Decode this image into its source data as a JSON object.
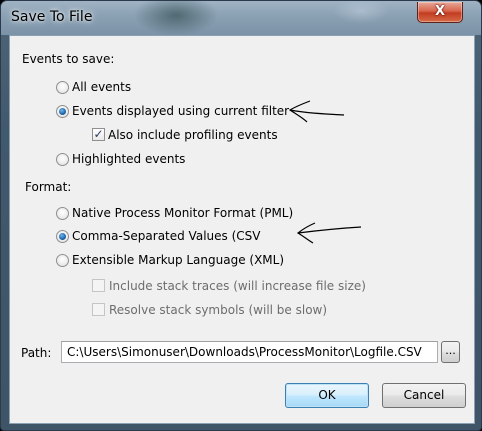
{
  "window": {
    "title": "Save To File",
    "close_glyph": "X"
  },
  "events_section": {
    "label": "Events to save:",
    "options": [
      {
        "label": "All events",
        "selected": false
      },
      {
        "label": "Events displayed using current filter",
        "selected": true
      },
      {
        "label": "Highlighted events",
        "selected": false
      }
    ],
    "profiling_checkbox": {
      "label": "Also include profiling events",
      "checked": true
    }
  },
  "format_section": {
    "label": "Format:",
    "options": [
      {
        "label": "Native Process Monitor Format (PML)",
        "selected": false
      },
      {
        "label": "Comma-Separated Values (CSV",
        "selected": true
      },
      {
        "label": "Extensible Markup Language (XML)",
        "selected": false
      }
    ],
    "xml_options": [
      {
        "label": "Include stack traces (will increase file size)",
        "checked": false,
        "enabled": false
      },
      {
        "label": "Resolve stack symbols (will be slow)",
        "checked": false,
        "enabled": false
      }
    ]
  },
  "path": {
    "label": "Path:",
    "value": "C:\\Users\\Simonuser\\Downloads\\ProcessMonitor\\Logfile.CSV",
    "browse_label": "..."
  },
  "buttons": {
    "ok_label": "OK",
    "cancel_label": "Cancel"
  },
  "check_glyph": "✓",
  "icons": {
    "close": "close-icon",
    "arrow": "hand-drawn-arrow-icon"
  }
}
